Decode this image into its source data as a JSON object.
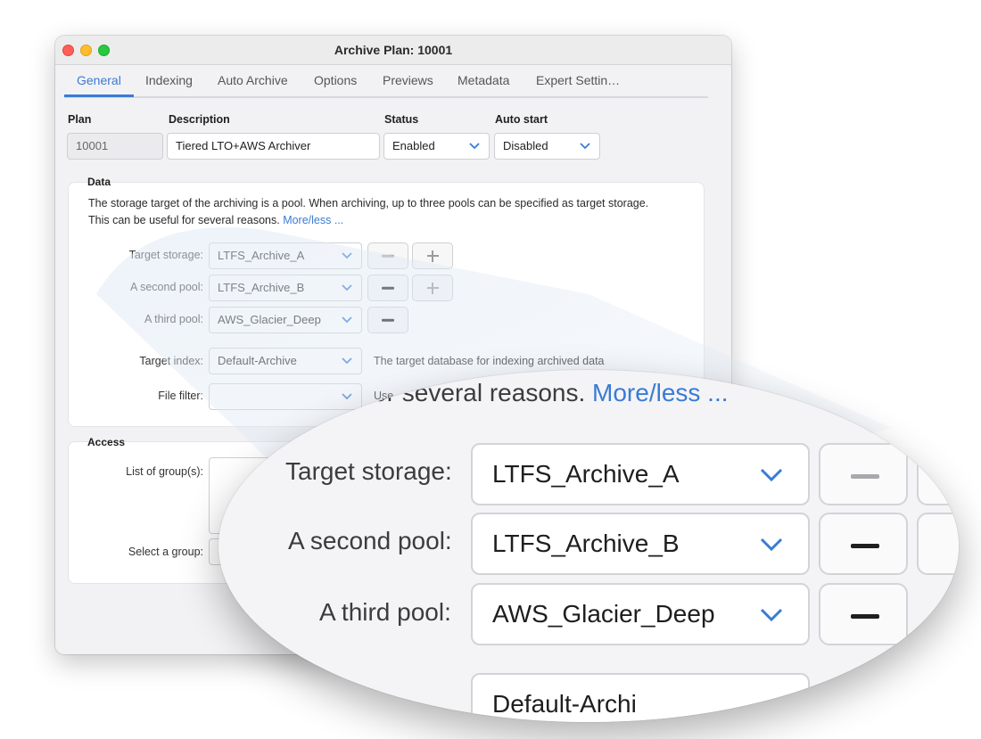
{
  "window": {
    "title": "Archive Plan: 10001"
  },
  "tabs": [
    {
      "label": "General",
      "active": true
    },
    {
      "label": "Indexing"
    },
    {
      "label": "Auto Archive"
    },
    {
      "label": "Options"
    },
    {
      "label": "Previews"
    },
    {
      "label": "Metadata"
    },
    {
      "label": "Expert Settin…"
    }
  ],
  "header": {
    "plan_label": "Plan",
    "plan_value": "10001",
    "description_label": "Description",
    "description_value": "Tiered LTO+AWS Archiver",
    "status_label": "Status",
    "status_value": "Enabled",
    "autostart_label": "Auto start",
    "autostart_value": "Disabled"
  },
  "data_panel": {
    "title": "Data",
    "description_line1": "The storage target of the archiving is a pool. When archiving, up to three pools can be specified as target storage.",
    "description_line2": "This can be useful for several reasons.",
    "more_less": "More/less ...",
    "target_storage_label": "Target storage:",
    "target_storage_value": "LTFS_Archive_A",
    "second_pool_label": "A second pool:",
    "second_pool_value": "LTFS_Archive_B",
    "third_pool_label": "A third pool:",
    "third_pool_value": "AWS_Glacier_Deep",
    "target_index_label": "Target index:",
    "target_index_value": "Default-Archive",
    "target_index_note": "The target database for indexing archived data",
    "file_filter_label": "File filter:",
    "file_filter_value": "",
    "file_filter_note": "Use"
  },
  "access_panel": {
    "title": "Access",
    "groups_label": "List of group(s):",
    "select_group_label": "Select a group:"
  },
  "magnifier": {
    "top_text": "ful for several reasons.",
    "more_less": "More/less ...",
    "target_storage_label": "Target storage:",
    "target_storage_value": "LTFS_Archive_A",
    "second_pool_label": "A second pool:",
    "second_pool_value": "LTFS_Archive_B",
    "third_pool_label": "A third pool:",
    "third_pool_value": "AWS_Glacier_Deep",
    "bottom_text": "Default-Archi"
  },
  "colors": {
    "accent": "#3a7bd5",
    "close": "#fe5f57",
    "minimize": "#febc2e",
    "maximize": "#28c840"
  }
}
